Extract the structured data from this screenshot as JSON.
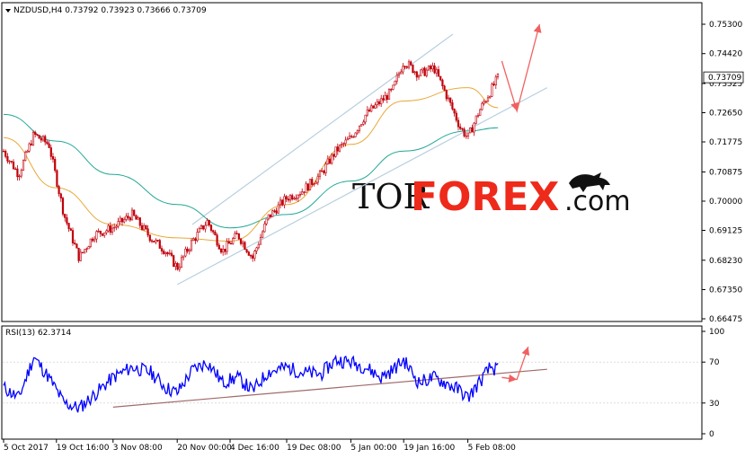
{
  "header": {
    "symbol_info": "NZDUSD,H4  0.73792 0.73923 0.73666 0.73709",
    "rsi_info": "RSI(13) 62.3714"
  },
  "watermark": {
    "part1": "TOR",
    "part2": "FOREX",
    "part3": ".com",
    "logo": "bull-icon"
  },
  "colors": {
    "candle": "#c0000b",
    "ma_fast": "#e8a93a",
    "ma_slow": "#22a896",
    "channel": "#b8cfe0",
    "forecast_arrow": "#f06060",
    "rsi_line": "#0000ff",
    "rsi_trend": "#a06a6a",
    "watermark_accent": "#ee2a1b"
  },
  "chart_data": [
    {
      "type": "candlestick",
      "symbol": "NZDUSD",
      "timeframe": "H4",
      "last_price": "0.73709",
      "ylim": [
        0.66475,
        0.753
      ],
      "y_ticks": [
        "0.75300",
        "0.74420",
        "0.73525",
        "0.72650",
        "0.71775",
        "0.70875",
        "0.70000",
        "0.69125",
        "0.68230",
        "0.67350",
        "0.66475"
      ],
      "x_ticks": [
        "5 Oct 2017",
        "19 Oct 16:00",
        "3 Nov 08:00",
        "20 Nov 00:00",
        "4 Dec 16:00",
        "19 Dec 08:00",
        "5 Jan 00:00",
        "19 Jan 16:00",
        "5 Feb 08:00"
      ],
      "price_path": {
        "x": [
          "5 Oct 2017",
          "9 Oct",
          "13 Oct",
          "17 Oct",
          "21 Oct",
          "25 Oct",
          "29 Oct",
          "3 Nov",
          "8 Nov",
          "13 Nov",
          "17 Nov",
          "20 Nov",
          "24 Nov",
          "28 Nov",
          "2 Dec",
          "6 Dec",
          "10 Dec",
          "14 Dec",
          "19 Dec",
          "23 Dec",
          "28 Dec",
          "1 Jan",
          "5 Jan",
          "9 Jan",
          "13 Jan",
          "16 Jan",
          "19 Jan",
          "23 Jan",
          "27 Jan",
          "31 Jan",
          "3 Feb",
          "5 Feb",
          "8 Feb",
          "11 Feb",
          "13 Feb"
        ],
        "y": [
          0.715,
          0.708,
          0.72,
          0.717,
          0.696,
          0.683,
          0.69,
          0.692,
          0.696,
          0.689,
          0.685,
          0.68,
          0.688,
          0.694,
          0.685,
          0.69,
          0.683,
          0.695,
          0.701,
          0.703,
          0.708,
          0.715,
          0.719,
          0.726,
          0.73,
          0.733,
          0.742,
          0.738,
          0.74,
          0.73,
          0.722,
          0.719,
          0.727,
          0.733,
          0.7371
        ]
      },
      "ma_fast": {
        "x": [
          "5 Oct 2017",
          "19 Oct",
          "3 Nov",
          "20 Nov",
          "4 Dec",
          "19 Dec",
          "5 Jan",
          "19 Jan",
          "5 Feb",
          "13 Feb"
        ],
        "y": [
          0.719,
          0.704,
          0.693,
          0.689,
          0.688,
          0.699,
          0.717,
          0.73,
          0.734,
          0.728
        ]
      },
      "ma_slow": {
        "x": [
          "5 Oct 2017",
          "19 Oct",
          "3 Nov",
          "20 Nov",
          "4 Dec",
          "19 Dec",
          "5 Jan",
          "19 Jan",
          "5 Feb",
          "13 Feb"
        ],
        "y": [
          0.726,
          0.718,
          0.708,
          0.699,
          0.692,
          0.696,
          0.706,
          0.715,
          0.721,
          0.722
        ]
      },
      "channel_upper": {
        "x": [
          "24 Nov",
          "1 Feb"
        ],
        "y": [
          0.693,
          0.75
        ]
      },
      "channel_lower": {
        "x": [
          "20 Nov",
          "26 Feb"
        ],
        "y": [
          0.675,
          0.734
        ]
      },
      "forecast": {
        "x": [
          "14 Feb",
          "18 Feb",
          "24 Feb"
        ],
        "y": [
          0.742,
          0.727,
          0.753
        ]
      }
    },
    {
      "type": "line",
      "name": "RSI(13)",
      "last_value": "62.3714",
      "ylim": [
        0,
        100
      ],
      "y_ticks": [
        "100",
        "70",
        "30",
        "0"
      ],
      "levels": [
        70,
        30
      ],
      "series": {
        "x": [
          "5 Oct 2017",
          "9 Oct",
          "13 Oct",
          "17 Oct",
          "21 Oct",
          "25 Oct",
          "29 Oct",
          "3 Nov",
          "8 Nov",
          "13 Nov",
          "17 Nov",
          "20 Nov",
          "24 Nov",
          "28 Nov",
          "2 Dec",
          "6 Dec",
          "10 Dec",
          "14 Dec",
          "19 Dec",
          "23 Dec",
          "28 Dec",
          "1 Jan",
          "5 Jan",
          "9 Jan",
          "13 Jan",
          "16 Jan",
          "19 Jan",
          "23 Jan",
          "27 Jan",
          "31 Jan",
          "3 Feb",
          "5 Feb",
          "8 Feb",
          "11 Feb",
          "13 Feb"
        ],
        "y": [
          45,
          35,
          75,
          55,
          30,
          25,
          38,
          55,
          65,
          60,
          45,
          40,
          62,
          70,
          50,
          55,
          42,
          60,
          65,
          60,
          58,
          72,
          70,
          65,
          55,
          62,
          72,
          50,
          55,
          48,
          42,
          35,
          50,
          65,
          62
        ]
      },
      "trendline": {
        "x": [
          "3 Nov",
          "26 Feb"
        ],
        "y": [
          26,
          63
        ]
      },
      "forecast": {
        "x": [
          "14 Feb",
          "18 Feb",
          "21 Feb"
        ],
        "y": [
          55,
          53,
          85
        ]
      }
    }
  ]
}
